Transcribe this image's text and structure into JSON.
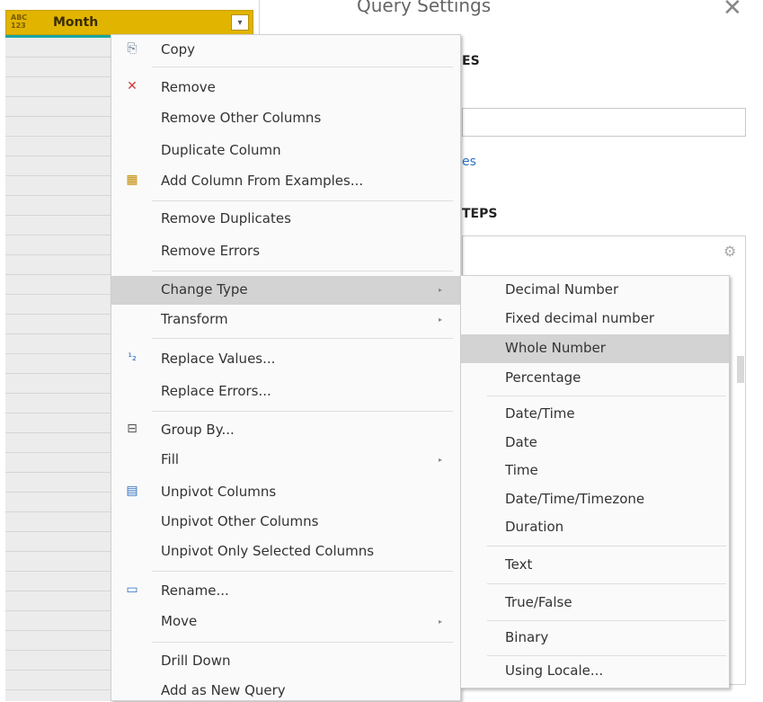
{
  "column": {
    "type_icon": "ABC\n123",
    "name": "Month",
    "dropdown": "▾"
  },
  "query_settings": {
    "title": "Query Settings",
    "close": "✕",
    "properties_heading": "ES",
    "name_value": "",
    "all_properties_link": "es",
    "applied_steps_heading": "TEPS",
    "gear": "⚙"
  },
  "menu": {
    "items": [
      {
        "label": "Copy",
        "icon": "copy-icon",
        "glyph": "⎘"
      },
      {
        "label": "Remove",
        "icon": "remove-column-icon",
        "glyph": "✕"
      },
      {
        "label": "Remove Other Columns"
      },
      {
        "label": "Duplicate Column"
      },
      {
        "label": "Add Column From Examples...",
        "icon": "add-column-examples-icon",
        "glyph": "▦"
      },
      {
        "label": "Remove Duplicates"
      },
      {
        "label": "Remove Errors"
      },
      {
        "label": "Change Type",
        "arrow": "▸"
      },
      {
        "label": "Transform",
        "arrow": "▸"
      },
      {
        "label": "Replace Values...",
        "icon": "replace-values-icon",
        "glyph": "¹₂"
      },
      {
        "label": "Replace Errors..."
      },
      {
        "label": "Group By...",
        "icon": "group-by-icon",
        "glyph": "⊟"
      },
      {
        "label": "Fill",
        "arrow": "▸"
      },
      {
        "label": "Unpivot Columns",
        "icon": "unpivot-icon",
        "glyph": "▤"
      },
      {
        "label": "Unpivot Other Columns"
      },
      {
        "label": "Unpivot Only Selected Columns"
      },
      {
        "label": "Rename...",
        "icon": "rename-icon",
        "glyph": "▭"
      },
      {
        "label": "Move",
        "arrow": "▸"
      },
      {
        "label": "Drill Down"
      },
      {
        "label": "Add as New Query"
      }
    ]
  },
  "submenu": {
    "items": [
      {
        "label": "Decimal Number"
      },
      {
        "label": "Fixed decimal number"
      },
      {
        "label": "Whole Number"
      },
      {
        "label": "Percentage"
      },
      {
        "label": "Date/Time"
      },
      {
        "label": "Date"
      },
      {
        "label": "Time"
      },
      {
        "label": "Date/Time/Timezone"
      },
      {
        "label": "Duration"
      },
      {
        "label": "Text"
      },
      {
        "label": "True/False"
      },
      {
        "label": "Binary"
      },
      {
        "label": "Using Locale..."
      }
    ]
  },
  "colors": {
    "header_gold": "#e1b400",
    "accent_teal": "#1aa6a0",
    "highlight": "#d3d3d3",
    "link_blue": "#2e6fbf"
  }
}
